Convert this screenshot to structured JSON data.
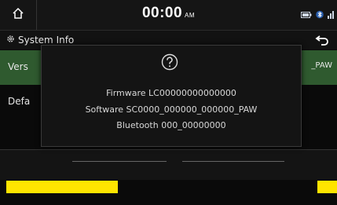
{
  "status_bar": {
    "time": "00:00",
    "ampm": "AM",
    "icons": [
      "home-icon",
      "battery-icon",
      "bluetooth-icon",
      "signal-icon"
    ]
  },
  "header": {
    "title": "System Info",
    "icon": "gear-icon",
    "back_icon": "back-arrow-icon"
  },
  "list": {
    "items": [
      {
        "label": "Vers",
        "selected": true
      },
      {
        "label": "Defa",
        "selected": false
      }
    ],
    "right_text": "_PAW"
  },
  "dialog": {
    "icon": "question-icon",
    "firmware": "Firmware LC00000000000000",
    "software": "Software SC0000_000000_000000_PAW",
    "bluetooth": "Bluetooth 000_00000000"
  },
  "colors": {
    "accent_green": "#2f5a2f",
    "highlight_yellow": "#ffe400"
  }
}
